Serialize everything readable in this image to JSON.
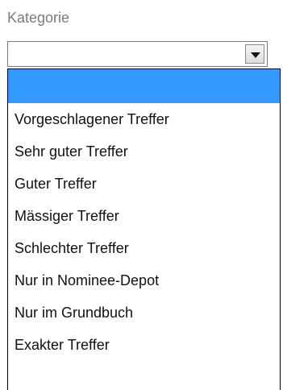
{
  "field": {
    "label": "Kategorie",
    "selected_value": ""
  },
  "icons": {
    "dropdown": "chevron-down-icon"
  },
  "colors": {
    "highlight": "#3399ff",
    "label": "#7b7b7b"
  },
  "options": [
    {
      "label": ""
    },
    {
      "label": "Vorgeschlagener Treffer"
    },
    {
      "label": "Sehr guter Treffer"
    },
    {
      "label": "Guter Treffer"
    },
    {
      "label": "Mässiger Treffer"
    },
    {
      "label": "Schlechter Treffer"
    },
    {
      "label": "Nur in Nominee-Depot"
    },
    {
      "label": "Nur im Grundbuch"
    },
    {
      "label": "Exakter Treffer"
    }
  ]
}
